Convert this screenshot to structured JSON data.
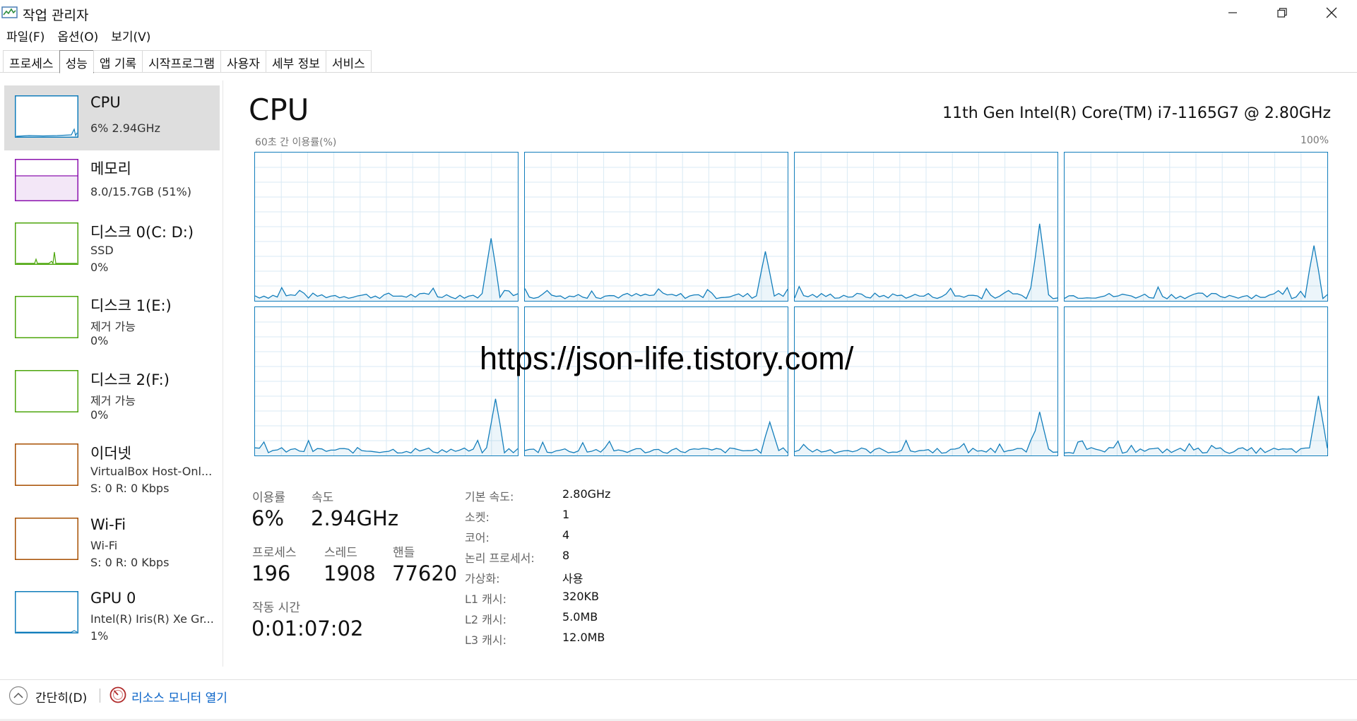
{
  "window": {
    "title": "작업 관리자"
  },
  "menu": [
    {
      "label": "파일(F)"
    },
    {
      "label": "옵션(O)"
    },
    {
      "label": "보기(V)"
    }
  ],
  "tabs": [
    {
      "label": "프로세스",
      "active": false
    },
    {
      "label": "성능",
      "active": true
    },
    {
      "label": "앱 기록",
      "active": false
    },
    {
      "label": "시작프로그램",
      "active": false
    },
    {
      "label": "사용자",
      "active": false
    },
    {
      "label": "세부 정보",
      "active": false
    },
    {
      "label": "서비스",
      "active": false
    }
  ],
  "sidebar": {
    "items": [
      {
        "title": "CPU",
        "line1": "6% 2.94GHz",
        "line2": "",
        "color": "#117dbb",
        "selected": true
      },
      {
        "title": "메모리",
        "line1": "8.0/15.7GB (51%)",
        "line2": "",
        "color": "#8b12ae",
        "selected": false
      },
      {
        "title": "디스크 0(C: D:)",
        "line1": "SSD",
        "line2": "0%",
        "color": "#4da60c",
        "selected": false
      },
      {
        "title": "디스크 1(E:)",
        "line1": "제거 가능",
        "line2": "0%",
        "color": "#4da60c",
        "selected": false
      },
      {
        "title": "디스크 2(F:)",
        "line1": "제거 가능",
        "line2": "0%",
        "color": "#4da60c",
        "selected": false
      },
      {
        "title": "이더넷",
        "line1": "VirtualBox Host-Onl...",
        "line2": "S: 0 R: 0 Kbps",
        "color": "#a74f01",
        "selected": false
      },
      {
        "title": "Wi-Fi",
        "line1": "Wi-Fi",
        "line2": "S: 0 R: 0 Kbps",
        "color": "#a74f01",
        "selected": false
      },
      {
        "title": "GPU 0",
        "line1": "Intel(R) Iris(R) Xe Gr...",
        "line2": "1%",
        "color": "#117dbb",
        "selected": false
      }
    ]
  },
  "main": {
    "title": "CPU",
    "model": "11th Gen Intel(R) Core(TM) i7-1165G7 @ 2.80GHz",
    "graph_caption": "60초 간 이용률(%)",
    "graph_max": "100%",
    "logical_processor_graphs": 8
  },
  "stats": {
    "utilization_label": "이용률",
    "utilization_value": "6%",
    "speed_label": "속도",
    "speed_value": "2.94GHz",
    "processes_label": "프로세스",
    "processes_value": "196",
    "threads_label": "스레드",
    "threads_value": "1908",
    "handles_label": "핸들",
    "handles_value": "77620",
    "uptime_label": "작동 시간",
    "uptime_value": "0:01:07:02"
  },
  "info": [
    {
      "label": "기본 속도:",
      "value": "2.80GHz"
    },
    {
      "label": "소켓:",
      "value": "1"
    },
    {
      "label": "코어:",
      "value": "4"
    },
    {
      "label": "논리 프로세서:",
      "value": "8"
    },
    {
      "label": "가상화:",
      "value": "사용"
    },
    {
      "label": "L1 캐시:",
      "value": "320KB"
    },
    {
      "label": "L2 캐시:",
      "value": "5.0MB"
    },
    {
      "label": "L3 캐시:",
      "value": "12.0MB"
    }
  ],
  "watermark": "https://json-life.tistory.com/",
  "footer": {
    "fewer_details": "간단히(D)",
    "open_resource_monitor": "리소스 모니터 열기"
  },
  "colors": {
    "cpu_line": "#117dbb",
    "grid": "#d9eaf4",
    "link": "#0a64c8"
  }
}
